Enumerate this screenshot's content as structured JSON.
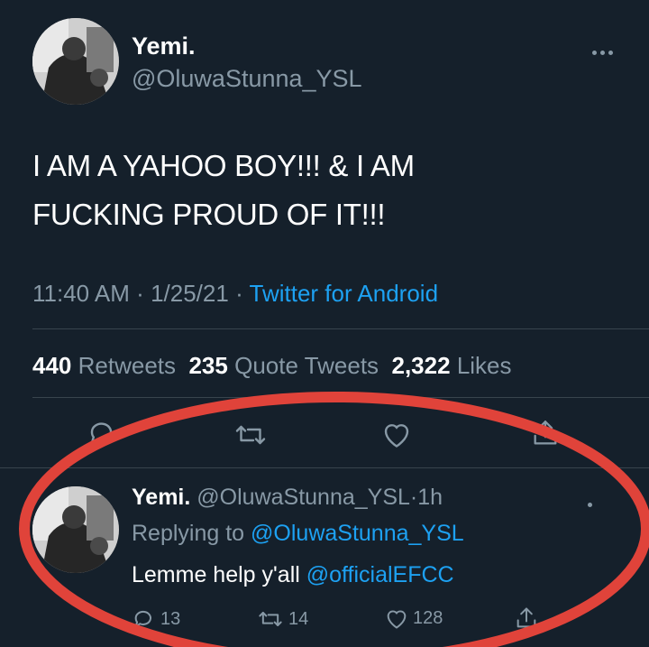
{
  "tweet": {
    "display_name": "Yemi.",
    "handle": "@OluwaStunna_YSL",
    "text_line1": "I AM A YAHOO BOY!!! & I AM",
    "text_line2": "FUCKING PROUD OF IT!!!",
    "time": "11:40 AM",
    "date_sep": "·",
    "date": "1/25/21",
    "source_sep": "·",
    "source": "Twitter for Android"
  },
  "stats": {
    "retweets_count": "440",
    "retweets_label": "Retweets",
    "quotes_count": "235",
    "quotes_label": "Quote Tweets",
    "likes_count": "2,322",
    "likes_label": "Likes"
  },
  "reply": {
    "display_name": "Yemi.",
    "handle": "@OluwaStunna_YSL",
    "sep": "·",
    "age": "1h",
    "replying_prefix": "Replying to",
    "replying_to": "@OluwaStunna_YSL",
    "text": "Lemme help y'all",
    "mention": "@officialEFCC",
    "reply_count": "13",
    "retweet_count": "14",
    "like_count": "128"
  },
  "colors": {
    "background": "#15202b",
    "muted": "#8899a6",
    "link": "#1da1f2",
    "annotation": "#e0433a"
  }
}
